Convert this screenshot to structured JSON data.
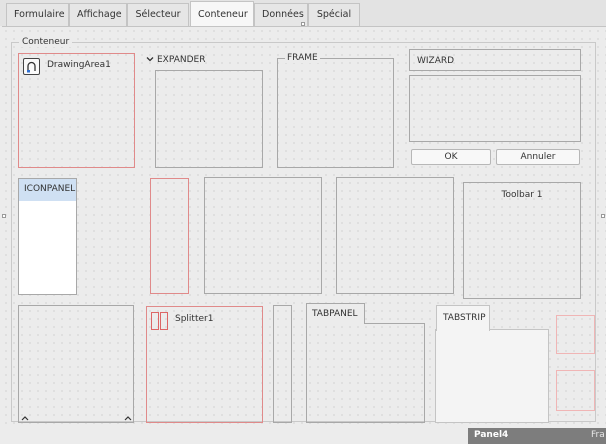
{
  "tabs": [
    {
      "label": "Formulaire"
    },
    {
      "label": "Affichage"
    },
    {
      "label": "Sélecteur"
    },
    {
      "label": "Conteneur",
      "active": true
    },
    {
      "label": "Données"
    },
    {
      "label": "Spécial"
    }
  ],
  "form": {
    "group_title": "Conteneur",
    "drawingarea_label": "DrawingArea1",
    "expander_label": "EXPANDER",
    "frame_label": "FRAME",
    "wizard_label": "WIZARD",
    "ok_label": "OK",
    "cancel_label": "Annuler",
    "iconpanel_label": "ICONPANEL",
    "toolbar_label": "Toolbar 1",
    "splitter_label": "Splitter1",
    "tabpanel_label": "TABPANEL",
    "tabstrip_label": "TABSTRIP"
  },
  "status": {
    "panel_label": "Panel4",
    "trailing_label": "Fra"
  },
  "colors": {
    "selected_outline": "#e08a8a",
    "iconpanel_header": "#cfe0f3",
    "panel_bar": "#7d7d7d"
  }
}
